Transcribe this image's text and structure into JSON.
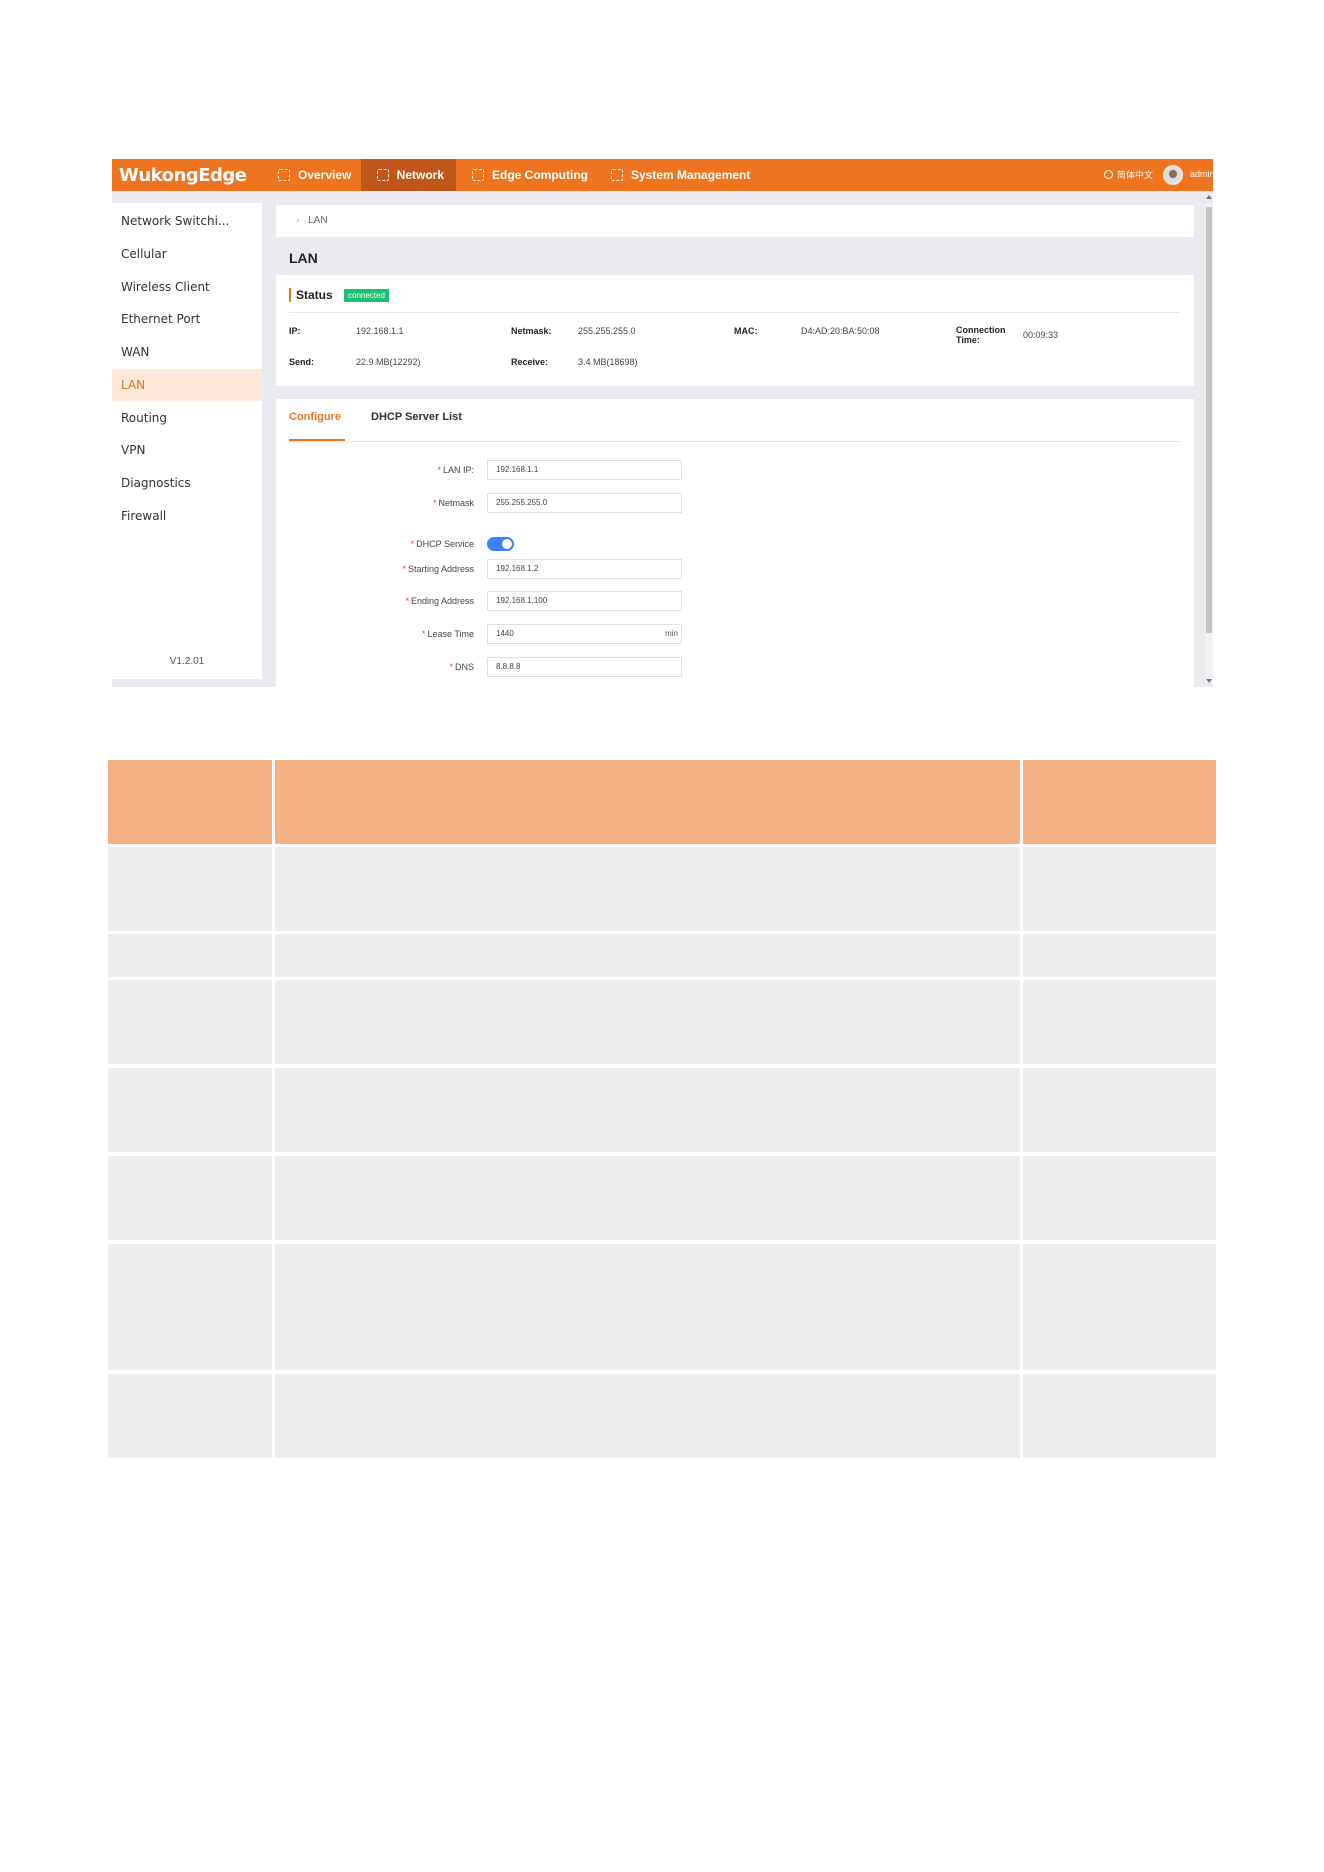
{
  "app": {
    "logo": "WukongEdge",
    "nav": [
      {
        "label": "Overview"
      },
      {
        "label": "Network"
      },
      {
        "label": "Edge Computing"
      },
      {
        "label": "System Management"
      }
    ],
    "language": "简体中文",
    "user": "admin",
    "accent_color": "#ee7420"
  },
  "sidebar": {
    "items": [
      {
        "label": "Network Switchi..."
      },
      {
        "label": "Cellular"
      },
      {
        "label": "Wireless Client"
      },
      {
        "label": "Ethernet Port"
      },
      {
        "label": "WAN"
      },
      {
        "label": "LAN"
      },
      {
        "label": "Routing"
      },
      {
        "label": "VPN"
      },
      {
        "label": "Diagnostics"
      },
      {
        "label": "Firewall"
      }
    ],
    "active_item": "LAN",
    "version": "V1.2.01"
  },
  "breadcrumb": {
    "current": "LAN"
  },
  "page": {
    "title": "LAN"
  },
  "status": {
    "heading": "Status",
    "badge": "connected",
    "badge_color": "#1dbf74",
    "ip_label": "IP:",
    "ip": "192.168.1.1",
    "netmask_label": "Netmask:",
    "netmask": "255.255.255.0",
    "mac_label": "MAC:",
    "mac": "D4:AD:20:BA:50:08",
    "conn_label_1": "Connection",
    "conn_label_2": "Time:",
    "conn_time": "00:09:33",
    "send_label": "Send:",
    "send": "22.9 MB(12292)",
    "receive_label": "Receive:",
    "receive": "3.4 MB(18698)"
  },
  "tabs": [
    {
      "label": "Configure"
    },
    {
      "label": "DHCP Server List"
    }
  ],
  "form": {
    "lan_ip_label": "LAN IP:",
    "lan_ip": "192.168.1.1",
    "netmask_label": "Netmask",
    "netmask": "255.255.255.0",
    "dhcp_label": "DHCP Service",
    "dhcp_enabled": true,
    "start_label": "Starting Address",
    "start": "192.168.1.2",
    "end_label": "Ending Address",
    "end": "192.168.1.100",
    "lease_label": "Lease Time",
    "lease": "1440",
    "lease_unit": "min",
    "dns_label": "DNS",
    "dns": "8.8.8.8",
    "required_mark": "*"
  },
  "table": {
    "header_color": "#f4b183",
    "row_color": "#ededed",
    "column_count": 3,
    "body_row_count": 7
  }
}
